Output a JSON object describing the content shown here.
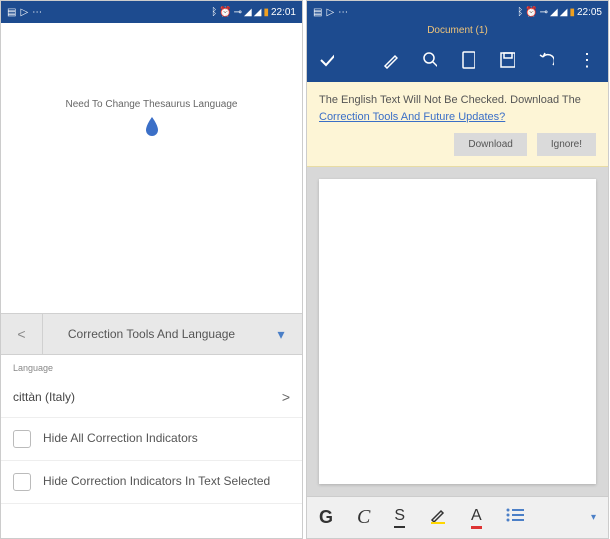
{
  "left": {
    "status": {
      "time": "22:01"
    },
    "thesaurus_msg": "Need To Change Thesaurus Language",
    "tab": {
      "back": "<",
      "label": "Correction Tools And Language",
      "dropdown": "▾"
    },
    "section_label": "Language",
    "language_item": "cittàn (Italy)",
    "chevron": ">",
    "hide_all": "Hide All Correction Indicators",
    "hide_selected": "Hide Correction Indicators In Text Selected"
  },
  "right": {
    "status": {
      "time": "22:05"
    },
    "doc_title": "Document (1)",
    "banner": {
      "line1": "The English Text Will Not Be Checked. Download The",
      "link": "Correction Tools And Future Updates?",
      "download": "Download",
      "ignore": "Ignore!"
    },
    "format": {
      "bold": "G",
      "italic": "C",
      "underline": "S",
      "font_color": "A"
    }
  }
}
